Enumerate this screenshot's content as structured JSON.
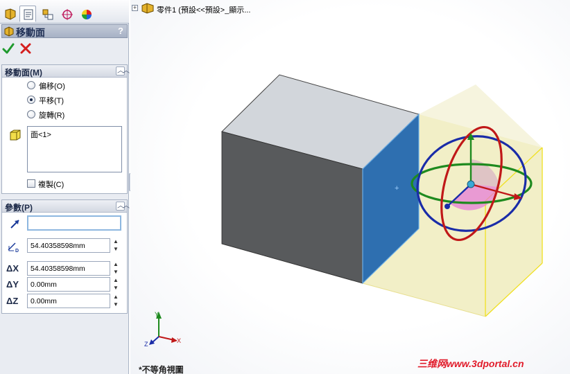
{
  "manager_tabs": [
    "feature-manager",
    "property-manager",
    "configuration-manager",
    "dimxpert-manager",
    "display-manager"
  ],
  "property_manager": {
    "title": "移動面",
    "help": "?",
    "ok_icon": "green-check-icon",
    "cancel_icon": "red-x-icon"
  },
  "move_face_group": {
    "title": "移動面(M)",
    "options": [
      {
        "label": "偏移(O)",
        "selected": false
      },
      {
        "label": "平移(T)",
        "selected": true
      },
      {
        "label": "旋轉(R)",
        "selected": false
      }
    ],
    "selection_items": [
      "面<1>"
    ],
    "copy_label": "複製(C)",
    "copy_checked": false
  },
  "parameters_group": {
    "title": "參數(P)",
    "direction_value": "",
    "distance": "54.40358598mm",
    "delta_x_label": "ΔX",
    "delta_x": "54.40358598mm",
    "delta_y_label": "ΔY",
    "delta_y": "0.00mm",
    "delta_z_label": "ΔZ",
    "delta_z": "0.00mm"
  },
  "tree_flyout": {
    "text": "零件1 (預設<<預設>_顯示..."
  },
  "triad": {
    "x_label": "X",
    "y_label": "Y",
    "z_label": "Z"
  },
  "view_label": "*不等角視圖",
  "watermark": "三维网www.3dportal.cn",
  "colors": {
    "panel_bg": "#e9ecf2",
    "selected_face": "#1f5fa0",
    "preview_face": "#ede9b4",
    "preview_edge": "#f0e020",
    "triad_ring_x": "#c01818",
    "triad_ring_y": "#1e8a1e",
    "triad_ring_z": "#1a2ca8",
    "watermark": "#e11b2a"
  }
}
